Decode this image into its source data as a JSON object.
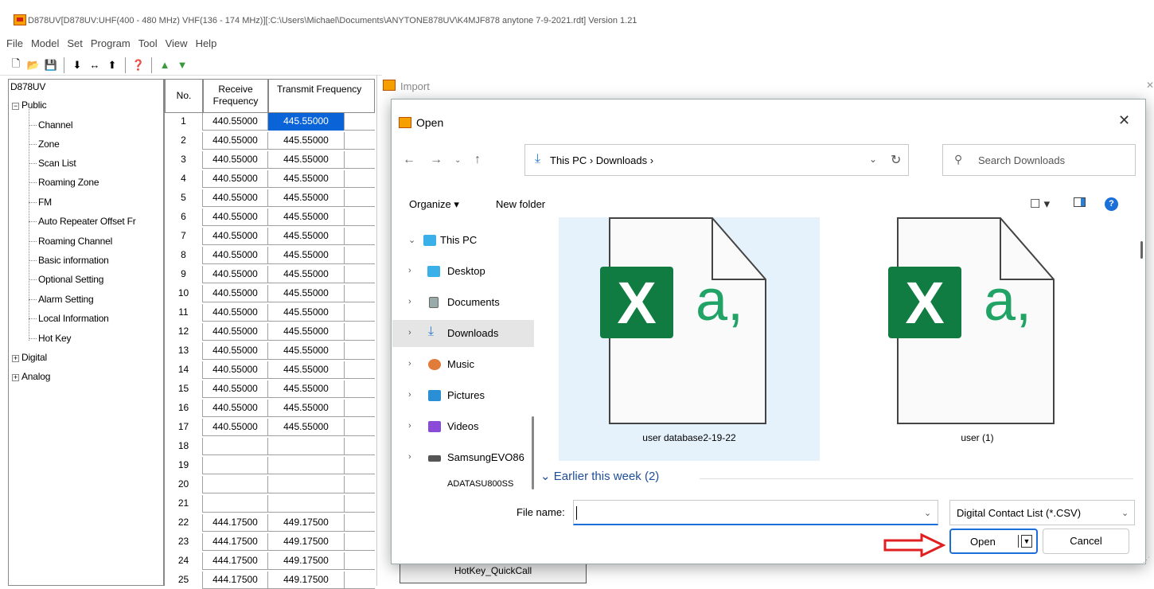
{
  "app": {
    "title": "D878UV[D878UV:UHF(400 - 480 MHz) VHF(136 - 174 MHz)][:C:\\Users\\Michael\\Documents\\ANYTONE878UV\\K4MJF878 anytone 7-9-2021.rdt] Version 1.21",
    "menu": [
      "File",
      "Model",
      "Set",
      "Program",
      "Tool",
      "View",
      "Help"
    ]
  },
  "tree": {
    "root": "D878UV",
    "public": "Public",
    "items": [
      "Channel",
      "Zone",
      "Scan List",
      "Roaming Zone",
      "FM",
      "Auto Repeater Offset Fr",
      "Roaming Channel",
      "Basic information",
      "Optional Setting",
      "Alarm Setting",
      "Local Information",
      "Hot Key"
    ],
    "digital": "Digital",
    "analog": "Analog"
  },
  "grid": {
    "headers": {
      "no": "No.",
      "receive": "Receive Frequency",
      "transmit": "Transmit Frequency"
    },
    "rows": [
      {
        "no": "1",
        "rx": "440.55000",
        "tx": "445.55000"
      },
      {
        "no": "2",
        "rx": "440.55000",
        "tx": "445.55000"
      },
      {
        "no": "3",
        "rx": "440.55000",
        "tx": "445.55000"
      },
      {
        "no": "4",
        "rx": "440.55000",
        "tx": "445.55000"
      },
      {
        "no": "5",
        "rx": "440.55000",
        "tx": "445.55000"
      },
      {
        "no": "6",
        "rx": "440.55000",
        "tx": "445.55000"
      },
      {
        "no": "7",
        "rx": "440.55000",
        "tx": "445.55000"
      },
      {
        "no": "8",
        "rx": "440.55000",
        "tx": "445.55000"
      },
      {
        "no": "9",
        "rx": "440.55000",
        "tx": "445.55000"
      },
      {
        "no": "10",
        "rx": "440.55000",
        "tx": "445.55000"
      },
      {
        "no": "11",
        "rx": "440.55000",
        "tx": "445.55000"
      },
      {
        "no": "12",
        "rx": "440.55000",
        "tx": "445.55000"
      },
      {
        "no": "13",
        "rx": "440.55000",
        "tx": "445.55000"
      },
      {
        "no": "14",
        "rx": "440.55000",
        "tx": "445.55000"
      },
      {
        "no": "15",
        "rx": "440.55000",
        "tx": "445.55000"
      },
      {
        "no": "16",
        "rx": "440.55000",
        "tx": "445.55000"
      },
      {
        "no": "17",
        "rx": "440.55000",
        "tx": "445.55000"
      },
      {
        "no": "18",
        "rx": "",
        "tx": ""
      },
      {
        "no": "19",
        "rx": "",
        "tx": ""
      },
      {
        "no": "20",
        "rx": "",
        "tx": ""
      },
      {
        "no": "21",
        "rx": "",
        "tx": ""
      },
      {
        "no": "22",
        "rx": "444.17500",
        "tx": "449.17500"
      },
      {
        "no": "23",
        "rx": "444.17500",
        "tx": "449.17500"
      },
      {
        "no": "24",
        "rx": "444.17500",
        "tx": "449.17500"
      },
      {
        "no": "25",
        "rx": "444.17500",
        "tx": "449.17500"
      }
    ]
  },
  "import": {
    "title": "Import",
    "tab_label": "HotKey_QuickCall"
  },
  "dialog": {
    "title": "Open",
    "address": "This PC  ›  Downloads  ›",
    "search_placeholder": "Search Downloads",
    "organize": "Organize ▾",
    "new_folder": "New folder",
    "nav": [
      {
        "label": "This PC",
        "icon": "monitor-icon"
      },
      {
        "label": "Desktop",
        "icon": "desktop-folder-icon"
      },
      {
        "label": "Documents",
        "icon": "documents-icon"
      },
      {
        "label": "Downloads",
        "icon": "download-icon"
      },
      {
        "label": "Music",
        "icon": "music-icon"
      },
      {
        "label": "Pictures",
        "icon": "pictures-icon"
      },
      {
        "label": "Videos",
        "icon": "videos-icon"
      },
      {
        "label": "SamsungEVO86",
        "icon": "drive-icon"
      },
      {
        "label": "ADATASU800SS",
        "icon": "drive-icon"
      }
    ],
    "files": [
      {
        "name": "user database2-19-22",
        "icon": "excel-csv-icon"
      },
      {
        "name": "user (1)",
        "icon": "excel-csv-icon"
      }
    ],
    "group_label": "Earlier this week (2)",
    "file_name_label": "File name:",
    "file_name_value": "",
    "file_type": "Digital Contact List (*.CSV)",
    "open_label": "Open",
    "cancel_label": "Cancel"
  },
  "colors": {
    "selection": "#0a64d8",
    "excel_green": "#107c41",
    "accent_blue": "#1a6fd8",
    "arrow_red": "#e02020"
  }
}
